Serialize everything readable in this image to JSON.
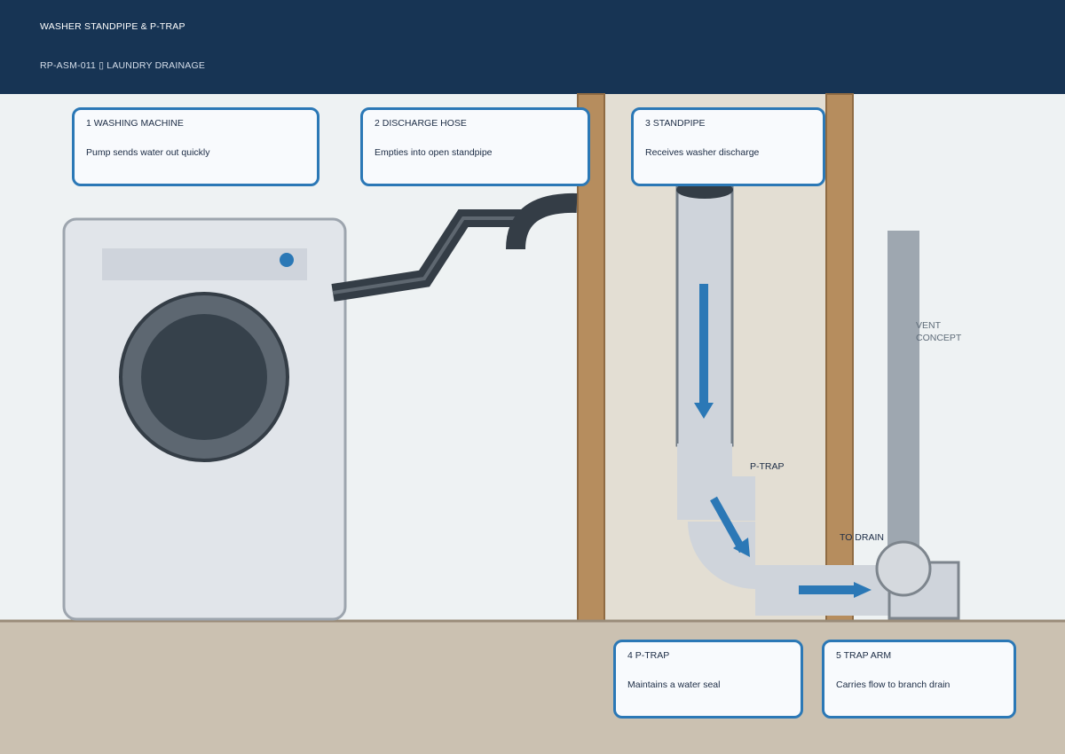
{
  "header": {
    "title": "WASHER STANDPIPE & P-TRAP",
    "subtitle": "RP-ASM-011 ▯ LAUNDRY DRAINAGE"
  },
  "callouts": [
    {
      "number": "1",
      "title": "WASHING MACHINE",
      "desc": "Pump sends water out quickly"
    },
    {
      "number": "2",
      "title": "DISCHARGE HOSE",
      "desc": "Empties into open standpipe"
    },
    {
      "number": "3",
      "title": "STANDPIPE",
      "desc": "Receives washer discharge"
    },
    {
      "number": "4",
      "title": "P-TRAP",
      "desc": "Maintains a water seal"
    },
    {
      "number": "5",
      "title": "TRAP ARM",
      "desc": "Carries flow to branch drain"
    }
  ],
  "labels": {
    "ptrap": "P-TRAP",
    "to_drain": "TO DRAIN",
    "vent_line1": "VENT",
    "vent_line2": "CONCEPT"
  },
  "colors": {
    "header": "#173454",
    "accent": "#2b78b6",
    "stud": "#b68d5e",
    "floor": "#cbc1b1",
    "pipe": "#cfd4db",
    "hose": "#37404a"
  }
}
